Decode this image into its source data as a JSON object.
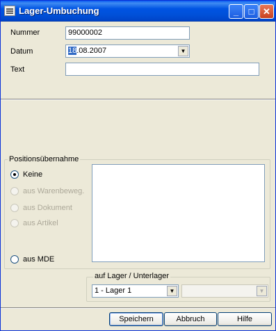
{
  "window": {
    "title": "Lager-Umbuchung",
    "controls": [
      "minimize",
      "maximize",
      "close"
    ]
  },
  "form": {
    "nummer_label": "Nummer",
    "nummer_value": "99000002",
    "datum_label": "Datum",
    "datum_value_selected": "18",
    "datum_value_rest": ".08.2007",
    "text_label": "Text",
    "text_value": ""
  },
  "positions": {
    "group_label": "Positionsübernahme",
    "options": [
      {
        "label": "Keine",
        "checked": true,
        "enabled": true
      },
      {
        "label": "aus Warenbeweg.",
        "checked": false,
        "enabled": false
      },
      {
        "label": "aus Dokument",
        "checked": false,
        "enabled": false
      },
      {
        "label": "aus Artikel",
        "checked": false,
        "enabled": false
      },
      {
        "label": "aus MDE",
        "checked": false,
        "enabled": true
      }
    ]
  },
  "lager": {
    "group_label": "auf Lager / Unterlager",
    "lager_value": "1 - Lager 1",
    "unterlager_value": ""
  },
  "buttons": {
    "save": "Speichern",
    "cancel": "Abbruch",
    "help": "Hilfe"
  },
  "icons": {
    "window_icon": "form-icon",
    "dropdown": "chevron-down-icon"
  }
}
